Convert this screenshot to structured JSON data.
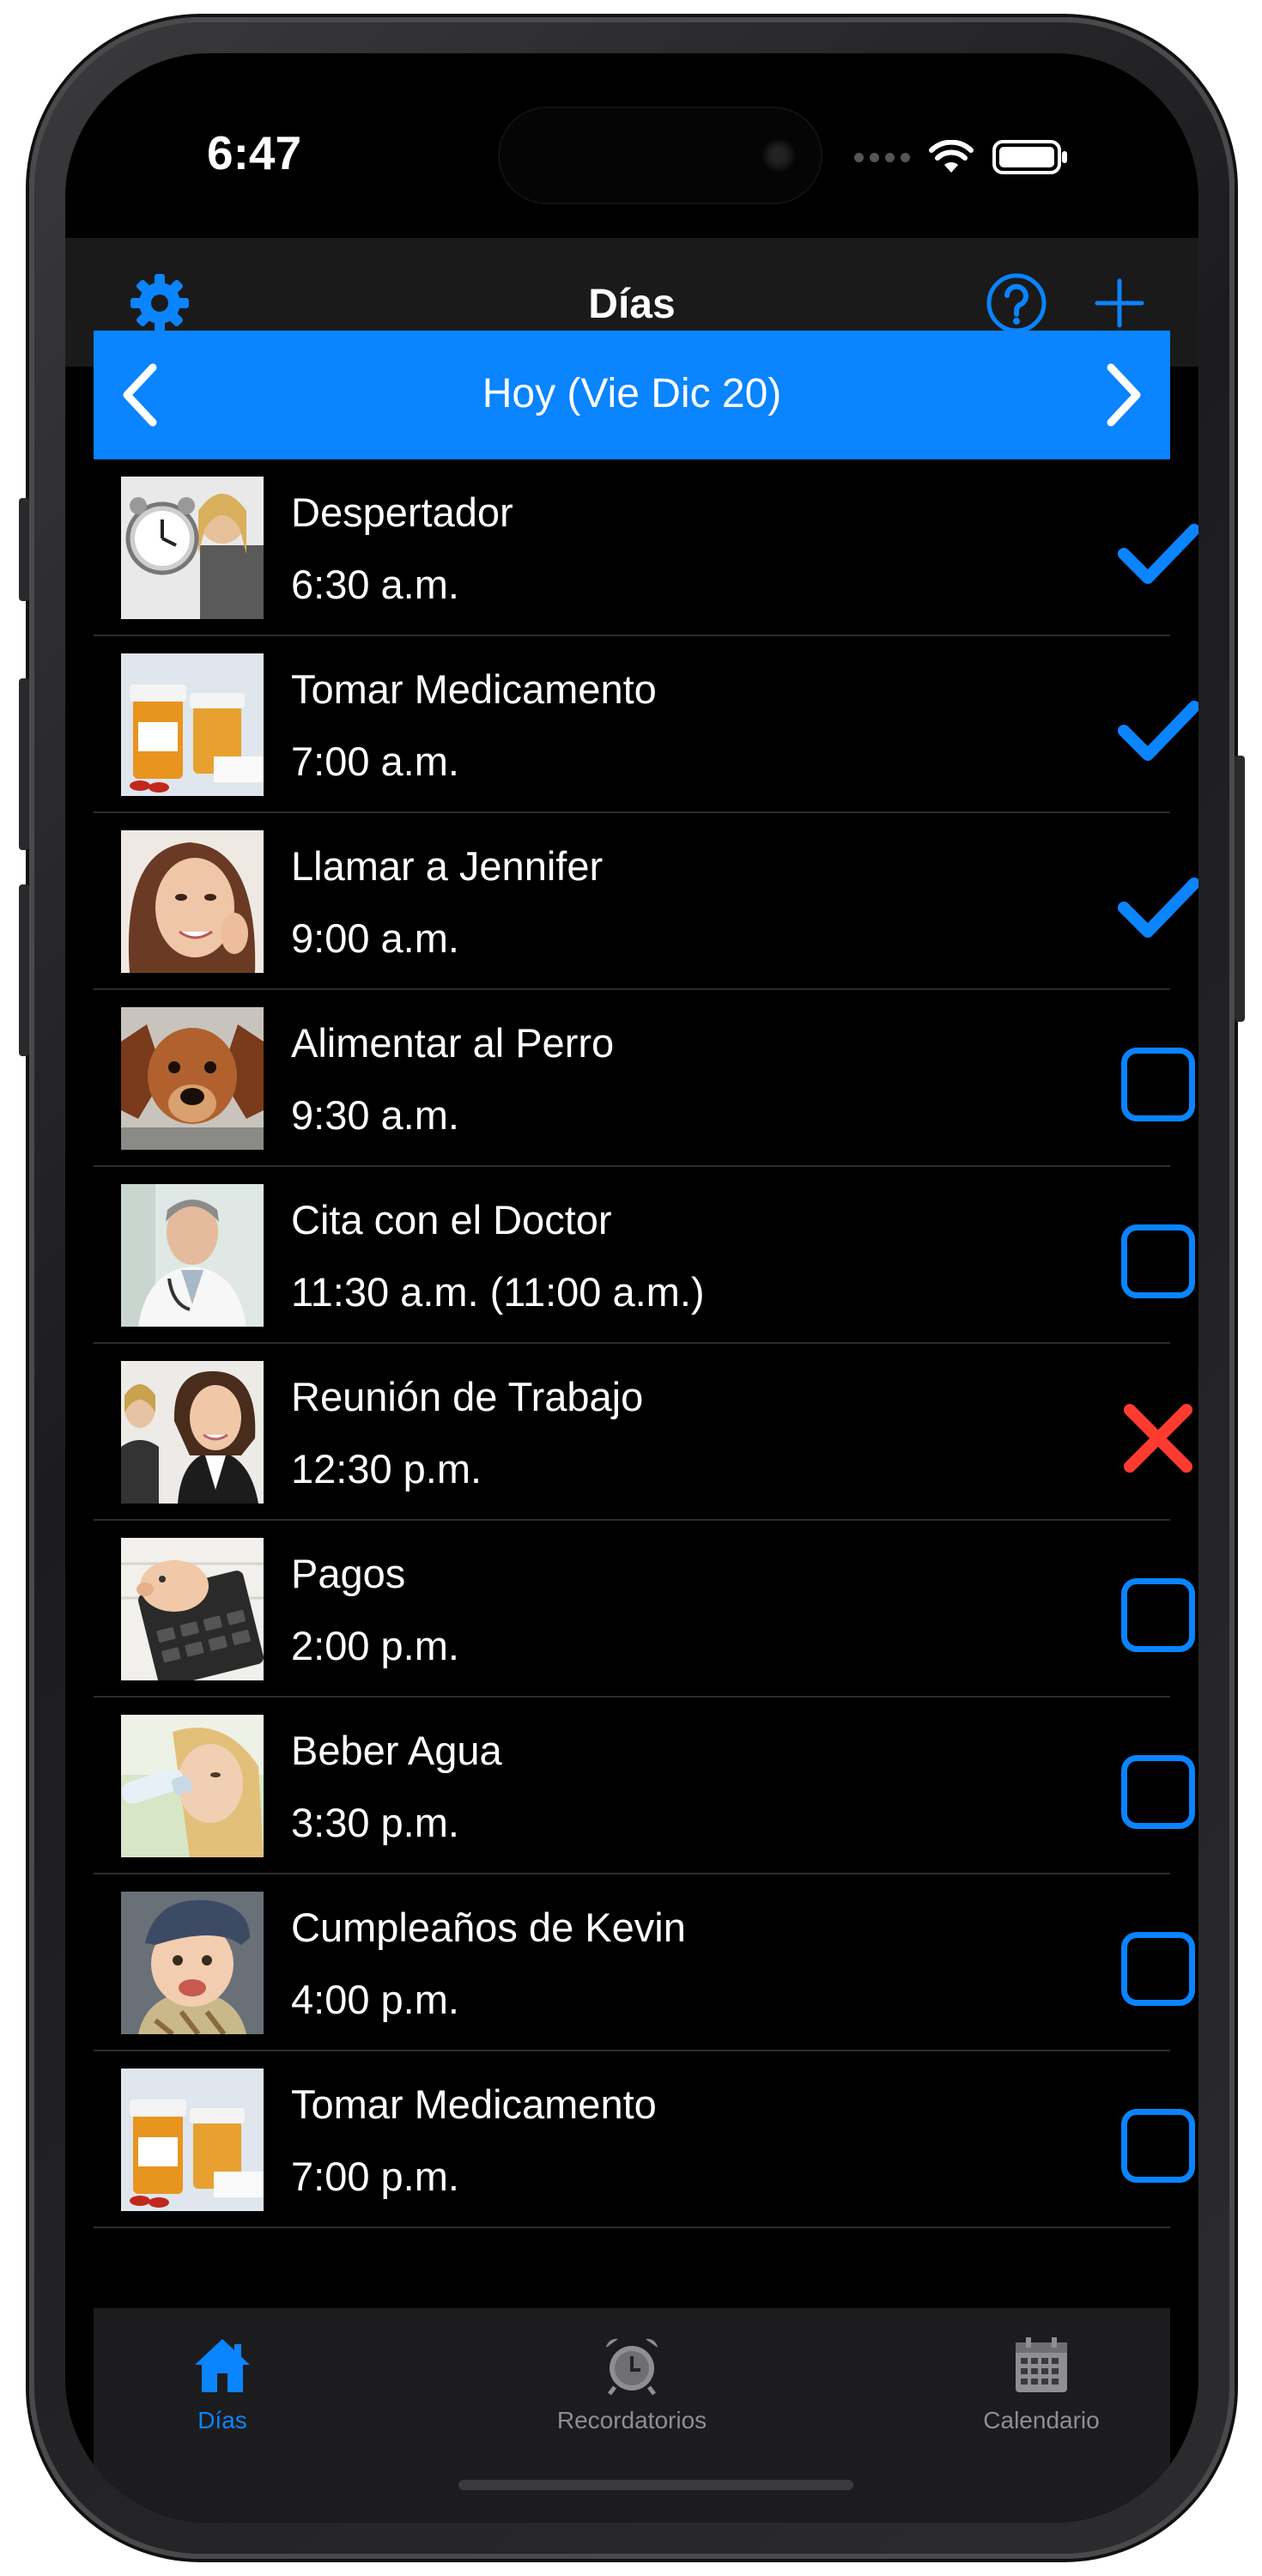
{
  "status_bar": {
    "time": "6:47"
  },
  "header": {
    "title": "Días"
  },
  "date_nav": {
    "label": "Hoy (Vie Dic 20)"
  },
  "reminders": [
    {
      "title": "Despertador",
      "time": "6:30 a.m.",
      "status": "done",
      "image": "alarm-clock-woman"
    },
    {
      "title": "Tomar Medicamento",
      "time": "7:00 a.m.",
      "status": "done",
      "image": "medicine-bottles"
    },
    {
      "title": "Llamar a Jennifer",
      "time": "9:00 a.m.",
      "status": "done",
      "image": "smiling-woman"
    },
    {
      "title": "Alimentar al Perro",
      "time": "9:30 a.m.",
      "status": "pending",
      "image": "dog"
    },
    {
      "title": "Cita con el Doctor",
      "time": "11:30 a.m. (11:00 a.m.)",
      "status": "pending",
      "image": "doctor"
    },
    {
      "title": "Reunión de Trabajo",
      "time": "12:30 p.m.",
      "status": "missed",
      "image": "business-women"
    },
    {
      "title": "Pagos",
      "time": "2:00 p.m.",
      "status": "pending",
      "image": "piggy-bank-calculator"
    },
    {
      "title": "Beber Agua",
      "time": "3:30 p.m.",
      "status": "pending",
      "image": "woman-drinking-water"
    },
    {
      "title": "Cumpleaños de Kevin",
      "time": "4:00 p.m.",
      "status": "pending",
      "image": "baby-with-cap"
    },
    {
      "title": "Tomar Medicamento",
      "time": "7:00 p.m.",
      "status": "pending",
      "image": "medicine-bottles"
    }
  ],
  "tabs": [
    {
      "label": "Días",
      "icon": "house-icon",
      "active": true
    },
    {
      "label": "Recordatorios",
      "icon": "alarm-clock-icon",
      "active": false
    },
    {
      "label": "Calendario",
      "icon": "calendar-icon",
      "active": false
    }
  ],
  "colors": {
    "accent": "#0a84ff",
    "missed": "#ff3b30",
    "background": "#000000",
    "inactive_tab": "#8e8e93"
  }
}
